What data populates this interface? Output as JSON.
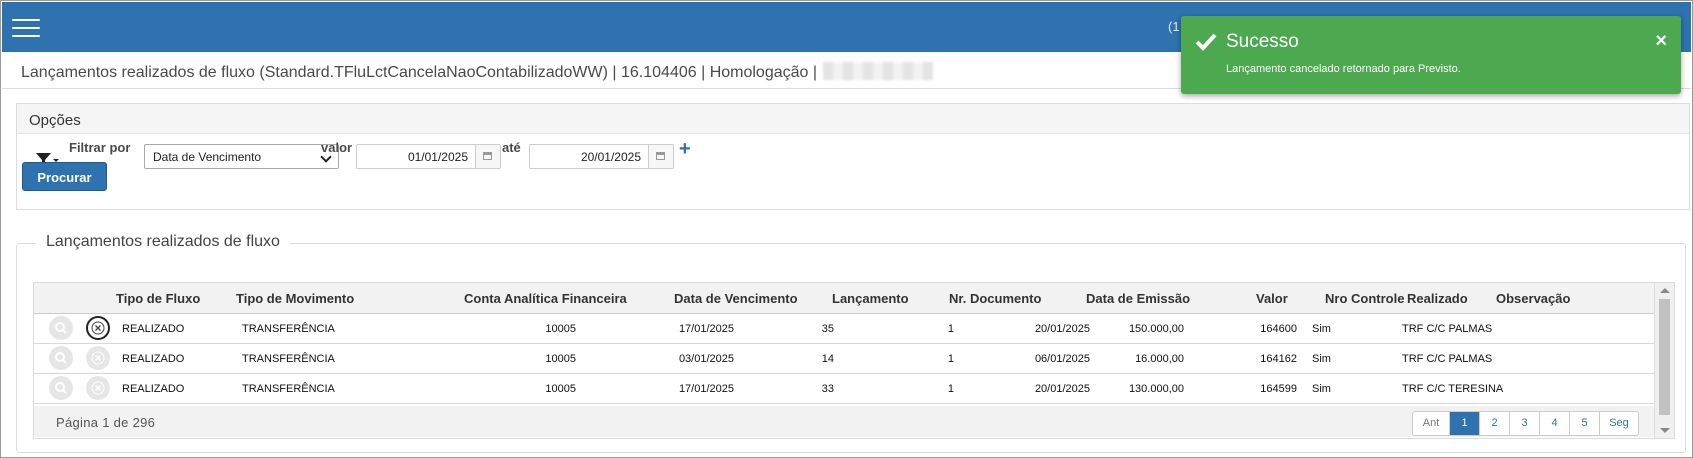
{
  "header": {
    "user_partial": "(1"
  },
  "page": {
    "title": "Lançamentos realizados de fluxo (Standard.TFluLctCancelaNaoContabilizadoWW) | 16.104406 | Homologação |"
  },
  "options": {
    "header": "Opções",
    "filter_label": "Filtrar por",
    "filter_field": "Data de Vencimento",
    "value_label": "valor",
    "from_date": "01/01/2025",
    "until_label": "até",
    "to_date": "20/01/2025",
    "add_label": "+",
    "search_button": "Procurar"
  },
  "results": {
    "legend": "Lançamentos realizados de fluxo",
    "columns": [
      "Tipo de Fluxo",
      "Tipo de Movimento",
      "Conta Analítica Financeira",
      "Data de Vencimento",
      "Lançamento",
      "Nr. Documento",
      "Data de Emissão",
      "Valor",
      "Nro Controle",
      "Realizado",
      "Observação"
    ],
    "rows": [
      {
        "tipo_fluxo": "REALIZADO",
        "tipo_movimento": "TRANSFERÊNCIA",
        "conta": "10005",
        "vencimento": "17/01/2025",
        "lancamento": "35",
        "documento": "1",
        "emissao": "20/01/2025",
        "valor": "150.000,00",
        "controle": "164600",
        "realizado": "Sim",
        "observacao": "TRF C/C PALMAS"
      },
      {
        "tipo_fluxo": "REALIZADO",
        "tipo_movimento": "TRANSFERÊNCIA",
        "conta": "10005",
        "vencimento": "03/01/2025",
        "lancamento": "14",
        "documento": "1",
        "emissao": "06/01/2025",
        "valor": "16.000,00",
        "controle": "164162",
        "realizado": "Sim",
        "observacao": "TRF C/C PALMAS"
      },
      {
        "tipo_fluxo": "REALIZADO",
        "tipo_movimento": "TRANSFERÊNCIA",
        "conta": "10005",
        "vencimento": "17/01/2025",
        "lancamento": "33",
        "documento": "1",
        "emissao": "20/01/2025",
        "valor": "130.000,00",
        "controle": "164599",
        "realizado": "Sim",
        "observacao": "TRF C/C TERESINA"
      }
    ],
    "page_info": "Página 1 de 296",
    "pager": {
      "prev": "Ant",
      "pages": [
        "1",
        "2",
        "3",
        "4",
        "5"
      ],
      "next": "Seg"
    }
  },
  "toast": {
    "title": "Sucesso",
    "message": "Lançamento cancelado retornado para Previsto.",
    "close": "×",
    "color": "#4da94f"
  },
  "colors": {
    "brand": "#2e72b0"
  }
}
